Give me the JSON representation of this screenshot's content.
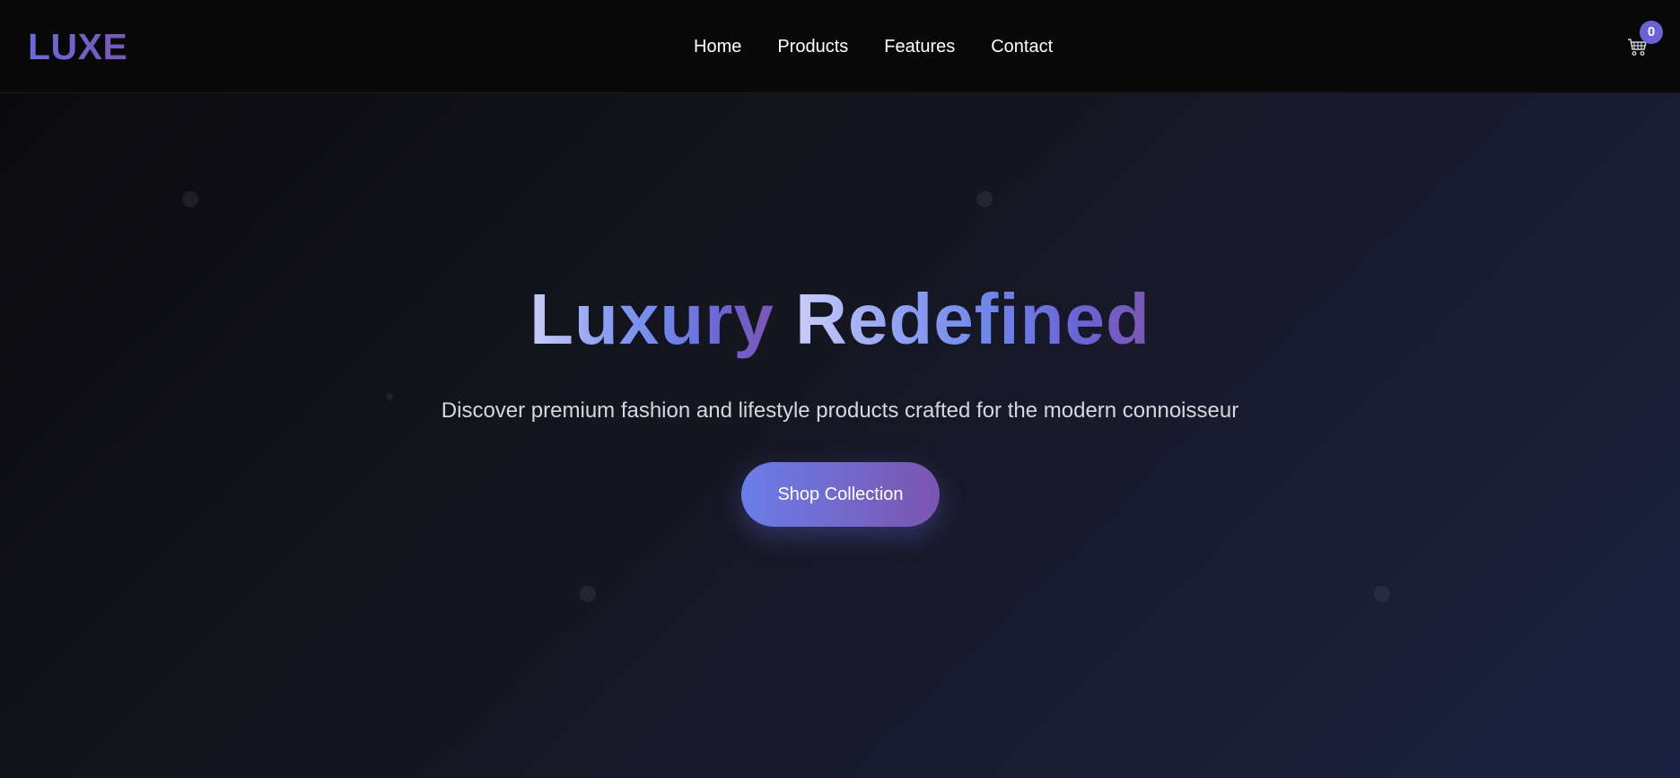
{
  "brand": {
    "logo_text": "LUXE"
  },
  "nav": {
    "items": [
      {
        "label": "Home"
      },
      {
        "label": "Products"
      },
      {
        "label": "Features"
      },
      {
        "label": "Contact"
      }
    ]
  },
  "cart": {
    "icon": "cart-icon",
    "count": "0",
    "badge_color": "#6b62d6"
  },
  "hero": {
    "title_word_1": "Luxury",
    "title_word_2": "Redefined",
    "subtitle": "Discover premium fashion and lifestyle products crafted for the modern connoisseur",
    "cta_label": "Shop Collection"
  },
  "colors": {
    "accent_start": "#6a7ee8",
    "accent_end": "#7b55b0",
    "header_bg": "#080808"
  }
}
